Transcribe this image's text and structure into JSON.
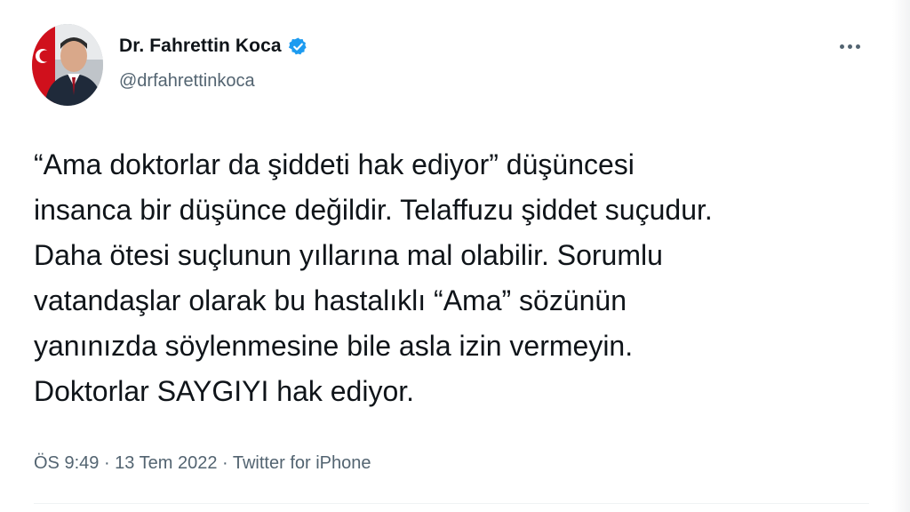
{
  "author": {
    "name": "Dr. Fahrettin Koca",
    "handle": "@drfahrettinkoca",
    "verified_color": "#1d9bf0"
  },
  "icons": {
    "verified": "verified-badge-icon",
    "more": "more-options-icon"
  },
  "tweet": {
    "lines": [
      "“Ama doktorlar da şiddeti hak ediyor” düşüncesi",
      "insanca bir düşünce değildir. Telaffuzu şiddet suçudur.",
      "Daha ötesi suçlunun yıllarına mal olabilir. Sorumlu",
      "vatandaşlar olarak bu hastalıklı “Ama” sözünün",
      "yanınızda söylenmesine bile asla izin vermeyin.",
      "Doktorlar SAYGIYI hak ediyor."
    ]
  },
  "meta": {
    "time": "ÖS 9:49",
    "separator": " · ",
    "date": "13 Tem 2022",
    "source": "Twitter for iPhone"
  }
}
